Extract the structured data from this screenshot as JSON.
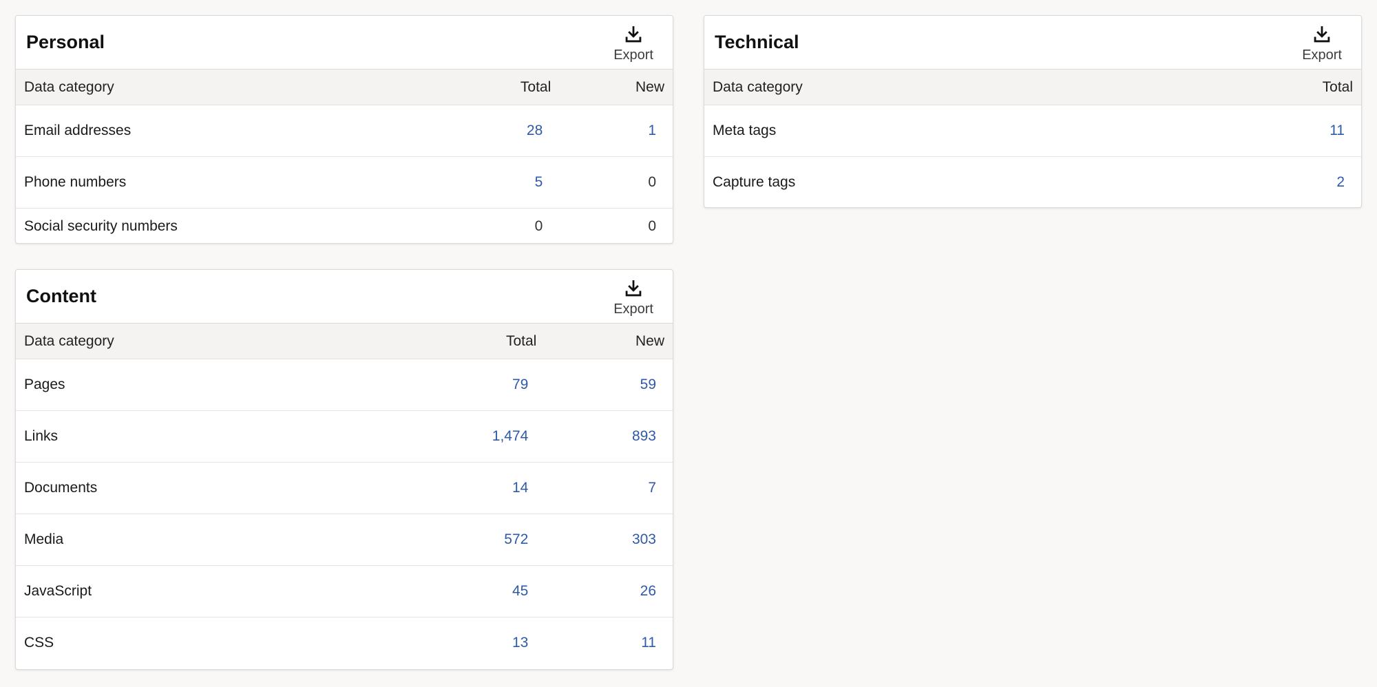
{
  "colors": {
    "link": "#2e5aa8",
    "header_bg": "#f4f3f2",
    "page_bg": "#f9f8f7"
  },
  "personal": {
    "title": "Personal",
    "export_label": "Export",
    "export_icon": "download-icon",
    "columns": [
      "Data category",
      "Total",
      "New"
    ],
    "rows": [
      {
        "category": "Email addresses",
        "total": "28",
        "new": "1"
      },
      {
        "category": "Phone numbers",
        "total": "5",
        "new": "0"
      },
      {
        "category": "Social security numbers",
        "total": "0",
        "new": "0"
      }
    ]
  },
  "technical": {
    "title": "Technical",
    "export_label": "Export",
    "export_icon": "download-icon",
    "columns": [
      "Data category",
      "Total"
    ],
    "rows": [
      {
        "category": "Meta tags",
        "total": "11"
      },
      {
        "category": "Capture tags",
        "total": "2"
      }
    ]
  },
  "content": {
    "title": "Content",
    "export_label": "Export",
    "export_icon": "download-icon",
    "columns": [
      "Data category",
      "Total",
      "New"
    ],
    "rows": [
      {
        "category": "Pages",
        "total": "79",
        "new": "59"
      },
      {
        "category": "Links",
        "total": "1,474",
        "new": "893"
      },
      {
        "category": "Documents",
        "total": "14",
        "new": "7"
      },
      {
        "category": "Media",
        "total": "572",
        "new": "303"
      },
      {
        "category": "JavaScript",
        "total": "45",
        "new": "26"
      },
      {
        "category": "CSS",
        "total": "13",
        "new": "11"
      }
    ]
  }
}
